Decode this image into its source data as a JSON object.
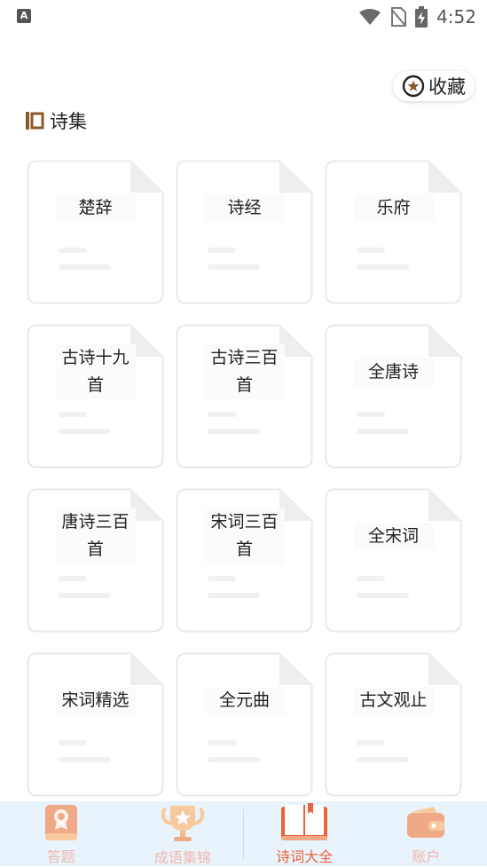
{
  "status_bar": {
    "app_badge": "A",
    "time": "4:52"
  },
  "header": {
    "collect_label": "收藏",
    "section_title": "诗集"
  },
  "collections": [
    {
      "title": "楚辞"
    },
    {
      "title": "诗经"
    },
    {
      "title": "乐府"
    },
    {
      "title": "古诗十九首"
    },
    {
      "title": "古诗三百首"
    },
    {
      "title": "全唐诗"
    },
    {
      "title": "唐诗三百首"
    },
    {
      "title": "宋词三百首"
    },
    {
      "title": "全宋词"
    },
    {
      "title": "宋词精选"
    },
    {
      "title": "全元曲"
    },
    {
      "title": "古文观止"
    }
  ],
  "bottom_nav": {
    "items": [
      {
        "label": "答题",
        "icon": "book-badge-icon",
        "active": false
      },
      {
        "label": "成语集锦",
        "icon": "trophy-icon",
        "active": false
      },
      {
        "label": "诗词大全",
        "icon": "open-book-icon",
        "active": true
      },
      {
        "label": "账户",
        "icon": "wallet-icon",
        "active": false
      }
    ]
  },
  "colors": {
    "accent": "#e7643d",
    "inactive_nav": "#f0b8ae",
    "nav_background": "#e9f3fb",
    "section_icon": "#8a5a2b"
  }
}
